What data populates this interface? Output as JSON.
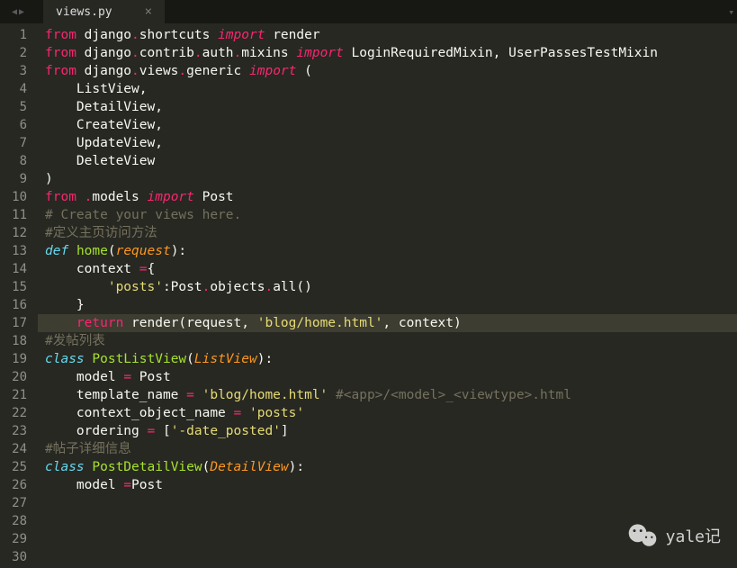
{
  "tab": {
    "name": "views.py",
    "close": "×"
  },
  "tabbar": {
    "arrow_left": "◀",
    "arrow_right": "▶",
    "menu": "▾"
  },
  "lines": [
    {
      "n": 1,
      "tokens": [
        [
          "kw",
          "from"
        ],
        [
          "pl",
          " django"
        ],
        [
          "op",
          "."
        ],
        [
          "pl",
          "shortcuts "
        ],
        [
          "kw-i",
          "import"
        ],
        [
          "pl",
          " render"
        ]
      ]
    },
    {
      "n": 2,
      "tokens": [
        [
          "kw",
          "from"
        ],
        [
          "pl",
          " django"
        ],
        [
          "op",
          "."
        ],
        [
          "pl",
          "contrib"
        ],
        [
          "op",
          "."
        ],
        [
          "pl",
          "auth"
        ],
        [
          "op",
          "."
        ],
        [
          "pl",
          "mixins "
        ],
        [
          "kw-i",
          "import"
        ],
        [
          "pl",
          " LoginRequiredMixin"
        ],
        [
          "pl",
          ","
        ],
        [
          "pl",
          " UserPassesTestMixin"
        ]
      ]
    },
    {
      "n": 3,
      "tokens": [
        [
          "kw",
          "from"
        ],
        [
          "pl",
          " django"
        ],
        [
          "op",
          "."
        ],
        [
          "pl",
          "views"
        ],
        [
          "op",
          "."
        ],
        [
          "pl",
          "generic "
        ],
        [
          "kw-i",
          "import"
        ],
        [
          "pl",
          " ("
        ]
      ]
    },
    {
      "n": 4,
      "tokens": [
        [
          "pl",
          "    ListView"
        ],
        [
          "pl",
          ","
        ]
      ]
    },
    {
      "n": 5,
      "tokens": [
        [
          "pl",
          "    DetailView"
        ],
        [
          "pl",
          ","
        ]
      ]
    },
    {
      "n": 6,
      "tokens": [
        [
          "pl",
          "    CreateView"
        ],
        [
          "pl",
          ","
        ]
      ]
    },
    {
      "n": 7,
      "tokens": [
        [
          "pl",
          "    UpdateView"
        ],
        [
          "pl",
          ","
        ]
      ]
    },
    {
      "n": 8,
      "tokens": [
        [
          "pl",
          "    DeleteView"
        ]
      ]
    },
    {
      "n": 9,
      "tokens": [
        [
          "pl",
          ")"
        ]
      ]
    },
    {
      "n": 10,
      "tokens": [
        [
          "kw",
          "from"
        ],
        [
          "pl",
          " "
        ],
        [
          "op",
          "."
        ],
        [
          "pl",
          "models "
        ],
        [
          "kw-i",
          "import"
        ],
        [
          "pl",
          " Post"
        ]
      ]
    },
    {
      "n": 11,
      "tokens": [
        [
          "cm",
          "# Create your views here."
        ]
      ]
    },
    {
      "n": 12,
      "tokens": [
        [
          "pl",
          ""
        ]
      ]
    },
    {
      "n": 13,
      "tokens": [
        [
          "cm",
          "#定义主页访问方法"
        ]
      ]
    },
    {
      "n": 14,
      "tokens": [
        [
          "cls",
          "def"
        ],
        [
          "pl",
          " "
        ],
        [
          "fn",
          "home"
        ],
        [
          "pl",
          "("
        ],
        [
          "arg",
          "request"
        ],
        [
          "pl",
          "):"
        ]
      ]
    },
    {
      "n": 15,
      "tokens": [
        [
          "pl",
          "    context "
        ],
        [
          "op",
          "="
        ],
        [
          "pl",
          "{"
        ]
      ]
    },
    {
      "n": 16,
      "tokens": [
        [
          "pl",
          "        "
        ],
        [
          "str",
          "'posts'"
        ],
        [
          "pl",
          ":Post"
        ],
        [
          "op",
          "."
        ],
        [
          "pl",
          "objects"
        ],
        [
          "op",
          "."
        ],
        [
          "pl",
          "all()"
        ]
      ]
    },
    {
      "n": 17,
      "hl": true,
      "tokens": [
        [
          "pl",
          "    }"
        ]
      ]
    },
    {
      "n": 18,
      "tokens": [
        [
          "pl",
          "    "
        ],
        [
          "kw",
          "return"
        ],
        [
          "pl",
          " render(request"
        ],
        [
          "pl",
          ","
        ],
        [
          "pl",
          " "
        ],
        [
          "str",
          "'blog/home.html'"
        ],
        [
          "pl",
          ","
        ],
        [
          "pl",
          " context)"
        ]
      ]
    },
    {
      "n": 19,
      "tokens": [
        [
          "pl",
          ""
        ]
      ]
    },
    {
      "n": 20,
      "tokens": [
        [
          "cm",
          "#发帖列表"
        ]
      ]
    },
    {
      "n": 21,
      "tokens": [
        [
          "cls",
          "class"
        ],
        [
          "pl",
          " "
        ],
        [
          "fn",
          "PostListView"
        ],
        [
          "pl",
          "("
        ],
        [
          "arg",
          "ListView"
        ],
        [
          "pl",
          "):"
        ]
      ]
    },
    {
      "n": 22,
      "tokens": [
        [
          "pl",
          "    model "
        ],
        [
          "op",
          "="
        ],
        [
          "pl",
          " Post"
        ]
      ]
    },
    {
      "n": 23,
      "tokens": [
        [
          "pl",
          "    template_name "
        ],
        [
          "op",
          "="
        ],
        [
          "pl",
          " "
        ],
        [
          "str",
          "'blog/home.html'"
        ],
        [
          "pl",
          " "
        ],
        [
          "cm",
          "#<app>/<model>_<viewtype>.html"
        ]
      ]
    },
    {
      "n": 24,
      "tokens": [
        [
          "pl",
          "    context_object_name "
        ],
        [
          "op",
          "="
        ],
        [
          "pl",
          " "
        ],
        [
          "str",
          "'posts'"
        ]
      ]
    },
    {
      "n": 25,
      "tokens": [
        [
          "pl",
          "    ordering "
        ],
        [
          "op",
          "="
        ],
        [
          "pl",
          " ["
        ],
        [
          "str",
          "'-date_posted'"
        ],
        [
          "pl",
          "]"
        ]
      ]
    },
    {
      "n": 26,
      "tokens": [
        [
          "pl",
          ""
        ]
      ]
    },
    {
      "n": 27,
      "tokens": [
        [
          "cm",
          "#帖子详细信息"
        ]
      ]
    },
    {
      "n": 28,
      "tokens": [
        [
          "cls",
          "class"
        ],
        [
          "pl",
          " "
        ],
        [
          "fn",
          "PostDetailView"
        ],
        [
          "pl",
          "("
        ],
        [
          "arg",
          "DetailView"
        ],
        [
          "pl",
          "):"
        ]
      ]
    },
    {
      "n": 29,
      "tokens": [
        [
          "pl",
          "    model "
        ],
        [
          "op",
          "="
        ],
        [
          "pl",
          "Post"
        ]
      ]
    },
    {
      "n": 30,
      "tokens": [
        [
          "pl",
          ""
        ]
      ]
    }
  ],
  "watermark": {
    "text": "yale记"
  }
}
